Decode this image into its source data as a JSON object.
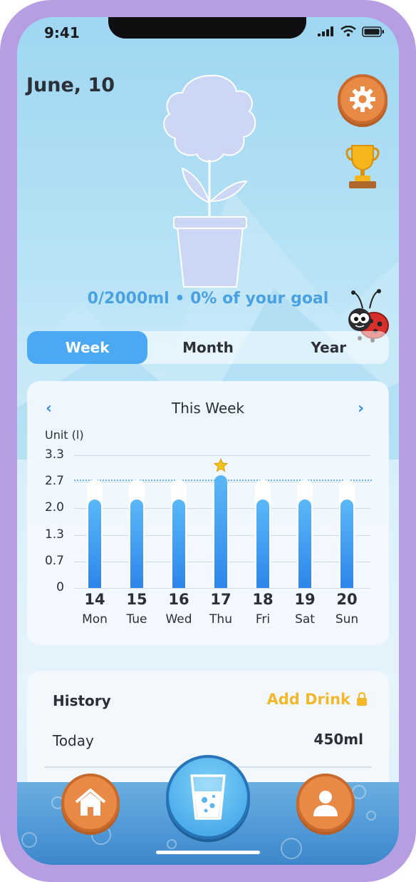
{
  "status_bar": {
    "time": "9:41"
  },
  "header": {
    "date": "June, 10"
  },
  "goal_text": "0/2000ml • 0% of your goal",
  "tabs": [
    {
      "label": "Week",
      "active": true
    },
    {
      "label": "Month",
      "active": false
    },
    {
      "label": "Year",
      "active": false
    }
  ],
  "chart_card": {
    "title": "This Week",
    "prev_icon": "chevron-left-icon",
    "next_icon": "chevron-right-icon"
  },
  "chart_data": {
    "type": "bar",
    "ylabel": "Unit (l)",
    "yticks": [
      "3.3",
      "2.7",
      "2.0",
      "1.3",
      "0.7",
      "0"
    ],
    "ylim": [
      0,
      3.3
    ],
    "goal_line": 2.7,
    "categories": [
      "14",
      "15",
      "16",
      "17",
      "18",
      "19",
      "20"
    ],
    "day_names": [
      "Mon",
      "Tue",
      "Wed",
      "Thu",
      "Fri",
      "Sat",
      "Sun"
    ],
    "values": [
      2.2,
      2.2,
      2.2,
      2.8,
      2.2,
      2.2,
      2.2
    ],
    "background_values": [
      2.7,
      2.7,
      2.7,
      2.7,
      2.7,
      2.7,
      2.7
    ],
    "highlight_index": 3,
    "colors": {
      "bar": "#2c86ea",
      "goal_line": "#68b3e8",
      "star": "#f5c21b"
    }
  },
  "history": {
    "title": "History",
    "add_drink_label": "Add Drink",
    "today_label": "Today",
    "today_value": "450ml"
  },
  "colors": {
    "accent": "#4aa8f5",
    "orange": "#e88945",
    "gold": "#f2b82a",
    "frame": "#b79ee3"
  }
}
